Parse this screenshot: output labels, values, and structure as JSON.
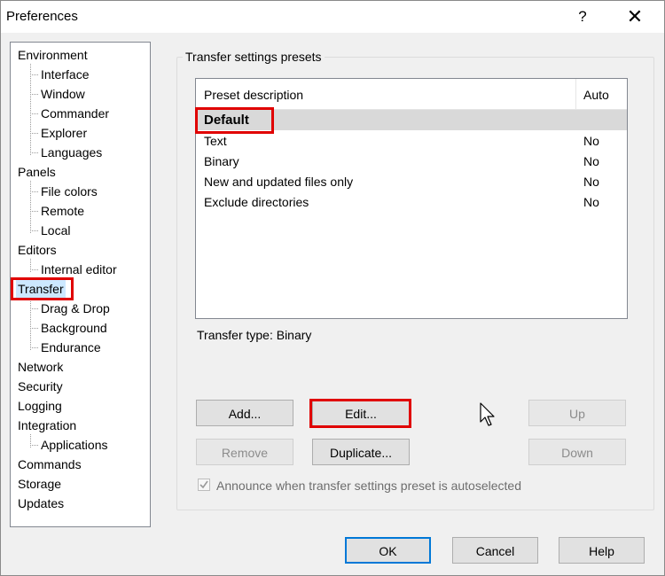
{
  "window": {
    "title": "Preferences",
    "help_glyph": "?",
    "close_glyph": "✕"
  },
  "tree": {
    "items": [
      {
        "label": "Environment"
      },
      {
        "label": "Interface"
      },
      {
        "label": "Window"
      },
      {
        "label": "Commander"
      },
      {
        "label": "Explorer"
      },
      {
        "label": "Languages"
      },
      {
        "label": "Panels"
      },
      {
        "label": "File colors"
      },
      {
        "label": "Remote"
      },
      {
        "label": "Local"
      },
      {
        "label": "Editors"
      },
      {
        "label": "Internal editor"
      },
      {
        "label": "Transfer"
      },
      {
        "label": "Drag & Drop"
      },
      {
        "label": "Background"
      },
      {
        "label": "Endurance"
      },
      {
        "label": "Network"
      },
      {
        "label": "Security"
      },
      {
        "label": "Logging"
      },
      {
        "label": "Integration"
      },
      {
        "label": "Applications"
      },
      {
        "label": "Commands"
      },
      {
        "label": "Storage"
      },
      {
        "label": "Updates"
      }
    ],
    "selected": "Transfer"
  },
  "presets": {
    "group_label": "Transfer settings presets",
    "columns": [
      "Preset description",
      "Auto"
    ],
    "rows": [
      {
        "description": "Default",
        "auto": ""
      },
      {
        "description": "Text",
        "auto": "No"
      },
      {
        "description": "Binary",
        "auto": "No"
      },
      {
        "description": "New and updated files only",
        "auto": "No"
      },
      {
        "description": "Exclude directories",
        "auto": "No"
      }
    ],
    "transfer_type": "Transfer type: Binary",
    "buttons": {
      "add": "Add...",
      "edit": "Edit...",
      "up": "Up",
      "remove": "Remove",
      "duplicate": "Duplicate...",
      "down": "Down"
    },
    "announce_label": "Announce when transfer settings preset is autoselected",
    "announce_checked": true
  },
  "footer": {
    "ok": "OK",
    "cancel": "Cancel",
    "help": "Help"
  },
  "colors": {
    "highlight": "#e00000",
    "selection": "#cce8ff",
    "default_button": "#0078d7"
  }
}
